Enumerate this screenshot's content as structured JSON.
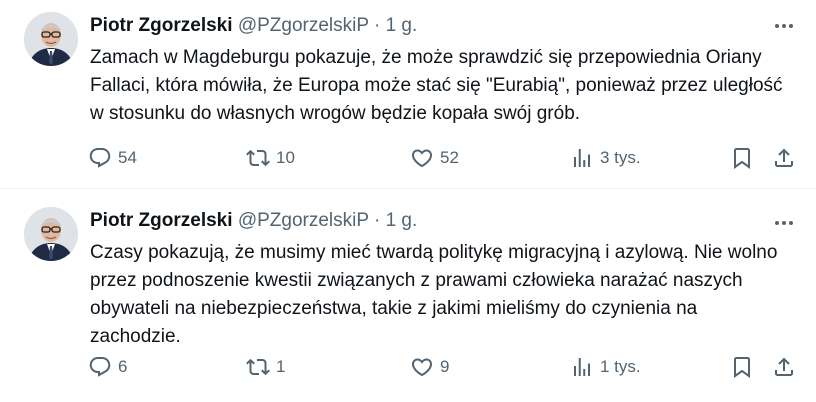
{
  "tweets": [
    {
      "author": {
        "name": "Piotr Zgorzelski",
        "handle": "@PZgorzelskiP"
      },
      "separator": "·",
      "time": "1 g.",
      "text": "Zamach w Magdeburgu pokazuje, że może sprawdzić się przepowiednia Oriany Fallaci, która mówiła, że Europa może stać się \"Eurabią\", ponieważ przez uległość w stosunku do własnych wrogów będzie kopała swój grób.",
      "replies": "54",
      "reposts": "10",
      "likes": "52",
      "views": "3 tys."
    },
    {
      "author": {
        "name": "Piotr Zgorzelski",
        "handle": "@PZgorzelskiP"
      },
      "separator": "·",
      "time": "1 g.",
      "text": "Czasy pokazują, że musimy mieć twardą politykę migracyjną i azylową. Nie wolno przez podnoszenie kwestii związanych z prawami człowieka narażać naszych obywateli na niebezpieczeństwa, takie z jakimi mieliśmy do czynienia na zachodzie.",
      "replies": "6",
      "reposts": "1",
      "likes": "9",
      "views": "1 tys."
    }
  ],
  "icons": {
    "more": "more-horizontal-icon",
    "reply": "reply-icon",
    "repost": "repost-icon",
    "like": "heart-icon",
    "views": "analytics-icon",
    "bookmark": "bookmark-icon",
    "share": "share-icon"
  },
  "colors": {
    "text": "#0f1419",
    "secondary": "#536471",
    "divider": "#eff3f4"
  }
}
